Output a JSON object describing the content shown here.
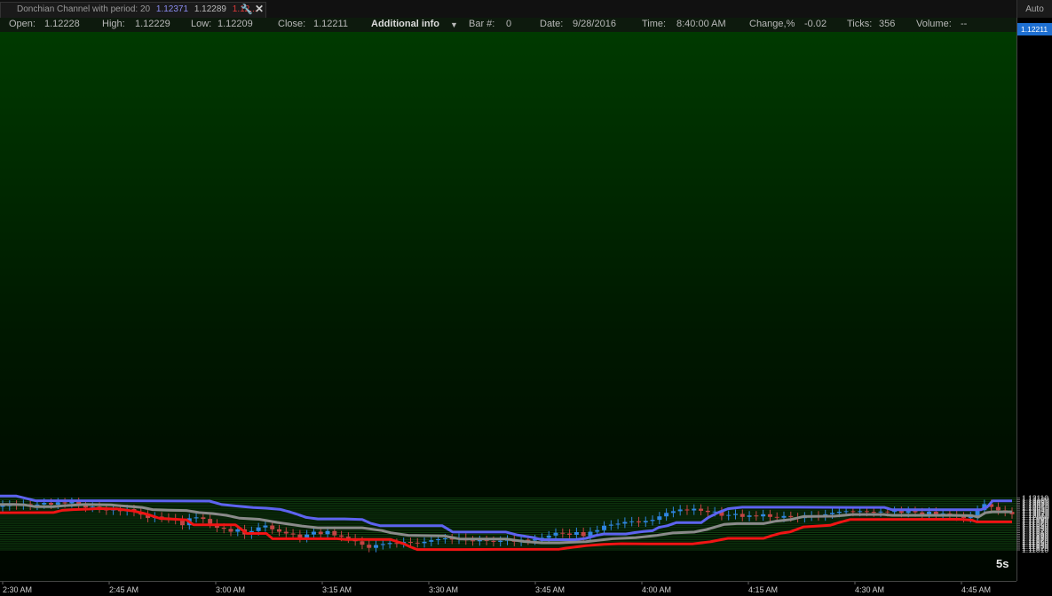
{
  "tab": {
    "label": "Donchian Channel with period: 20",
    "upper_value": "1.12371",
    "mid_value": "1.12289",
    "lower_value": "1.12..."
  },
  "toolbar": {
    "auto_label": "Auto",
    "period_label": "5s"
  },
  "infobar": {
    "open_label": "Open:",
    "open_value": "1.12228",
    "high_label": "High:",
    "high_value": "1.12229",
    "low_label": "Low:",
    "low_value": "1.12209",
    "close_label": "Close:",
    "close_value": "1.12211",
    "additional_info": "Additional info",
    "bar_label": "Bar #:",
    "bar_value": "0",
    "date_label": "Date:",
    "date_value": "9/28/2016",
    "time_label": "Time:",
    "time_value": "8:40:00 AM",
    "change_label": "Change,%",
    "change_value": "-0.02",
    "ticks_label": "Ticks:",
    "ticks_value": "356",
    "volume_label": "Volume:",
    "volume_value": "--"
  },
  "colors": {
    "upper_channel": "#5d63f0",
    "middle_channel": "#8a8a8a",
    "lower_channel": "#f01414",
    "bull_candle": "#2f86e0",
    "bear_candle": "#c24444",
    "price_marker": "#1e6fd1"
  },
  "chart_data": {
    "type": "candlestick",
    "current_price": "1.12211",
    "y_ticks": [
      "1.12110",
      "1.12100",
      "1.12090",
      "1.12080",
      "1.12070",
      "1.12060",
      "1.12050",
      "1.12040",
      "1.12030",
      "1.12020",
      "1.12010",
      "1.12000",
      "1.11990",
      "1.11980",
      "1.11970",
      "1.11960",
      "1.11950",
      "1.11940",
      "1.11930",
      "1.11920",
      "1.11910",
      "1.11900",
      "1.11890",
      "1.11880",
      "1.11870",
      "1.11860",
      "1.11850",
      "1.11840",
      "1.11830",
      "1.11820",
      "1.11810"
    ],
    "x_ticks": [
      "2:30 AM",
      "2:45 AM",
      "3:00 AM",
      "3:15 AM",
      "3:30 AM",
      "3:45 AM",
      "4:00 AM",
      "4:15 AM",
      "4:30 AM",
      "4:45 AM"
    ],
    "ylim": [
      1.11805,
      1.12115
    ],
    "candles": [
      [
        1.12059,
        1.12071
      ],
      [
        1.12063,
        1.12071
      ],
      [
        1.12071,
        1.12068
      ],
      [
        1.12068,
        1.12075
      ],
      [
        1.12075,
        1.12066
      ],
      [
        1.12066,
        1.12073
      ],
      [
        1.12073,
        1.12082
      ],
      [
        1.12082,
        1.12072
      ],
      [
        1.12072,
        1.12085
      ],
      [
        1.12085,
        1.12079
      ],
      [
        1.12079,
        1.12087
      ],
      [
        1.12087,
        1.12069
      ],
      [
        1.12069,
        1.12055
      ],
      [
        1.12055,
        1.1206
      ],
      [
        1.1206,
        1.1205
      ],
      [
        1.1205,
        1.12038
      ],
      [
        1.12038,
        1.12047
      ],
      [
        1.12047,
        1.12034
      ],
      [
        1.12034,
        1.12046
      ],
      [
        1.12046,
        1.1203
      ],
      [
        1.1203,
        1.12014
      ],
      [
        1.12014,
        1.11995
      ],
      [
        1.11995,
        1.12003
      ],
      [
        1.12003,
        1.11996
      ],
      [
        1.11996,
        1.11992
      ],
      [
        1.11992,
        1.11983
      ],
      [
        1.11983,
        1.11953
      ],
      [
        1.11953,
        1.11993
      ],
      [
        1.11993,
        1.11998
      ],
      [
        1.11998,
        1.11989
      ],
      [
        1.11989,
        1.11962
      ],
      [
        1.11962,
        1.11938
      ],
      [
        1.11938,
        1.11932
      ],
      [
        1.11932,
        1.11915
      ],
      [
        1.11915,
        1.11929
      ],
      [
        1.11929,
        1.11899
      ],
      [
        1.11899,
        1.11919
      ],
      [
        1.11919,
        1.1194
      ],
      [
        1.1194,
        1.11951
      ],
      [
        1.11951,
        1.11929
      ],
      [
        1.11929,
        1.11915
      ],
      [
        1.11915,
        1.11905
      ],
      [
        1.11905,
        1.11899
      ],
      [
        1.11899,
        1.11879
      ],
      [
        1.11879,
        1.11899
      ],
      [
        1.11899,
        1.11915
      ],
      [
        1.11915,
        1.11901
      ],
      [
        1.11901,
        1.11919
      ],
      [
        1.11919,
        1.11894
      ],
      [
        1.11894,
        1.11886
      ],
      [
        1.11886,
        1.11876
      ],
      [
        1.11876,
        1.1186
      ],
      [
        1.1186,
        1.1184
      ],
      [
        1.1184,
        1.11822
      ],
      [
        1.11822,
        1.11838
      ],
      [
        1.11838,
        1.11844
      ],
      [
        1.11844,
        1.1185
      ],
      [
        1.1185,
        1.11849
      ],
      [
        1.11849,
        1.11856
      ],
      [
        1.11856,
        1.11852
      ],
      [
        1.11852,
        1.11849
      ],
      [
        1.11849,
        1.11857
      ],
      [
        1.11857,
        1.11866
      ],
      [
        1.11866,
        1.11872
      ],
      [
        1.11872,
        1.11877
      ],
      [
        1.11877,
        1.1187
      ],
      [
        1.1187,
        1.11879
      ],
      [
        1.11879,
        1.11865
      ],
      [
        1.11865,
        1.1186
      ],
      [
        1.1186,
        1.11867
      ],
      [
        1.11867,
        1.11862
      ],
      [
        1.11862,
        1.11856
      ],
      [
        1.11856,
        1.11863
      ],
      [
        1.11863,
        1.1187
      ],
      [
        1.1187,
        1.11857
      ],
      [
        1.11857,
        1.11869
      ],
      [
        1.11869,
        1.11864
      ],
      [
        1.11864,
        1.11872
      ],
      [
        1.11872,
        1.1188
      ],
      [
        1.1188,
        1.11893
      ],
      [
        1.11893,
        1.11909
      ],
      [
        1.11909,
        1.11905
      ],
      [
        1.11905,
        1.11897
      ],
      [
        1.11897,
        1.11913
      ],
      [
        1.11913,
        1.1189
      ],
      [
        1.1189,
        1.11915
      ],
      [
        1.11915,
        1.11924
      ],
      [
        1.11924,
        1.1195
      ],
      [
        1.1195,
        1.11956
      ],
      [
        1.11956,
        1.11962
      ],
      [
        1.11962,
        1.11972
      ],
      [
        1.11972,
        1.11975
      ],
      [
        1.11975,
        1.11969
      ],
      [
        1.11969,
        1.11977
      ],
      [
        1.11977,
        1.11984
      ],
      [
        1.11984,
        1.12004
      ],
      [
        1.12004,
        1.12024
      ],
      [
        1.12024,
        1.12034
      ],
      [
        1.12034,
        1.12044
      ],
      [
        1.12044,
        1.12038
      ],
      [
        1.12038,
        1.12048
      ],
      [
        1.12048,
        1.12036
      ],
      [
        1.12036,
        1.12029
      ],
      [
        1.12029,
        1.12032
      ],
      [
        1.12032,
        1.12007
      ],
      [
        1.12007,
        1.12012
      ],
      [
        1.12012,
        1.12018
      ],
      [
        1.12018,
        1.12001
      ],
      [
        1.12001,
        1.12009
      ],
      [
        1.12009,
        1.12004
      ],
      [
        1.12004,
        1.12016
      ],
      [
        1.12016,
        1.12001
      ],
      [
        1.12001,
        1.11996
      ],
      [
        1.11996,
        1.12006
      ],
      [
        1.12006,
        1.11999
      ],
      [
        1.11999,
        1.11994
      ],
      [
        1.11994,
        1.12003
      ],
      [
        1.12003,
        1.12009
      ],
      [
        1.12009,
        1.12004
      ],
      [
        1.12004,
        1.12016
      ],
      [
        1.12016,
        1.12024
      ],
      [
        1.12024,
        1.12031
      ],
      [
        1.12031,
        1.12034
      ],
      [
        1.12034,
        1.1203
      ],
      [
        1.1203,
        1.12034
      ],
      [
        1.12034,
        1.1203
      ],
      [
        1.1203,
        1.12027
      ],
      [
        1.12027,
        1.12032
      ],
      [
        1.12032,
        1.12029
      ],
      [
        1.12029,
        1.12035
      ],
      [
        1.12035,
        1.12024
      ],
      [
        1.12024,
        1.12035
      ],
      [
        1.12035,
        1.12027
      ],
      [
        1.12027,
        1.12017
      ],
      [
        1.12017,
        1.12031
      ],
      [
        1.12031,
        1.12014
      ],
      [
        1.12014,
        1.12021
      ],
      [
        1.12021,
        1.12011
      ],
      [
        1.12011,
        1.12003
      ],
      [
        1.12003,
        1.11994
      ],
      [
        1.11994,
        1.12005
      ],
      [
        1.12005,
        1.1204
      ],
      [
        1.1204,
        1.12075
      ],
      [
        1.12075,
        1.12058
      ],
      [
        1.12058,
        1.12039
      ],
      [
        1.12039,
        1.1203
      ],
      [
        1.1203,
        1.12016
      ]
    ],
    "upper": [
      [
        0,
        1.12122
      ],
      [
        18,
        1.12122
      ],
      [
        40,
        1.12094
      ],
      [
        100,
        1.12094
      ],
      [
        236,
        1.12092
      ],
      [
        250,
        1.12072
      ],
      [
        266,
        1.12064
      ],
      [
        285,
        1.12055
      ],
      [
        300,
        1.12051
      ],
      [
        316,
        1.12044
      ],
      [
        326,
        1.1203
      ],
      [
        335,
        1.12016
      ],
      [
        345,
        1.11998
      ],
      [
        358,
        1.11989
      ],
      [
        388,
        1.11989
      ],
      [
        408,
        1.11986
      ],
      [
        418,
        1.11963
      ],
      [
        428,
        1.1195
      ],
      [
        498,
        1.1195
      ],
      [
        510,
        1.11913
      ],
      [
        570,
        1.11913
      ],
      [
        582,
        1.11897
      ],
      [
        600,
        1.11882
      ],
      [
        610,
        1.11869
      ],
      [
        630,
        1.11869
      ],
      [
        648,
        1.11869
      ],
      [
        660,
        1.11877
      ],
      [
        672,
        1.11894
      ],
      [
        680,
        1.11902
      ],
      [
        705,
        1.11902
      ],
      [
        715,
        1.1191
      ],
      [
        725,
        1.11917
      ],
      [
        735,
        1.11921
      ],
      [
        742,
        1.1194
      ],
      [
        752,
        1.1195
      ],
      [
        762,
        1.11968
      ],
      [
        790,
        1.11968
      ],
      [
        798,
        1.11998
      ],
      [
        808,
        1.12024
      ],
      [
        820,
        1.12048
      ],
      [
        836,
        1.12057
      ],
      [
        900,
        1.12057
      ],
      [
        960,
        1.12056
      ],
      [
        996,
        1.12056
      ],
      [
        1005,
        1.12042
      ],
      [
        1105,
        1.12042
      ],
      [
        1112,
        1.12058
      ],
      [
        1118,
        1.12093
      ],
      [
        1140,
        1.12093
      ]
    ],
    "middle": [
      [
        0,
        1.12072
      ],
      [
        15,
        1.12073
      ],
      [
        28,
        1.1207
      ],
      [
        40,
        1.1206
      ],
      [
        60,
        1.1206
      ],
      [
        72,
        1.12066
      ],
      [
        95,
        1.12072
      ],
      [
        125,
        1.1207
      ],
      [
        160,
        1.12056
      ],
      [
        172,
        1.12043
      ],
      [
        190,
        1.1204
      ],
      [
        210,
        1.12038
      ],
      [
        224,
        1.12026
      ],
      [
        240,
        1.1202
      ],
      [
        255,
        1.1201
      ],
      [
        270,
        1.11993
      ],
      [
        292,
        1.11987
      ],
      [
        312,
        1.11969
      ],
      [
        340,
        1.11948
      ],
      [
        358,
        1.11938
      ],
      [
        408,
        1.11938
      ],
      [
        430,
        1.11922
      ],
      [
        440,
        1.11909
      ],
      [
        460,
        1.11894
      ],
      [
        500,
        1.11891
      ],
      [
        518,
        1.11873
      ],
      [
        570,
        1.11873
      ],
      [
        590,
        1.11859
      ],
      [
        610,
        1.11851
      ],
      [
        630,
        1.11851
      ],
      [
        660,
        1.11858
      ],
      [
        690,
        1.11875
      ],
      [
        716,
        1.11881
      ],
      [
        740,
        1.11894
      ],
      [
        758,
        1.11908
      ],
      [
        782,
        1.11913
      ],
      [
        796,
        1.11928
      ],
      [
        804,
        1.1194
      ],
      [
        816,
        1.11958
      ],
      [
        830,
        1.11962
      ],
      [
        860,
        1.11962
      ],
      [
        873,
        1.11975
      ],
      [
        890,
        1.11985
      ],
      [
        905,
        1.12003
      ],
      [
        940,
        1.12005
      ],
      [
        960,
        1.12015
      ],
      [
        995,
        1.12015
      ],
      [
        1005,
        1.1201
      ],
      [
        1070,
        1.1201
      ],
      [
        1095,
        1.12008
      ],
      [
        1102,
        1.12
      ],
      [
        1110,
        1.12025
      ],
      [
        1118,
        1.1203
      ],
      [
        1140,
        1.1203
      ]
    ],
    "lower": [
      [
        0,
        1.12025
      ],
      [
        60,
        1.12026
      ],
      [
        70,
        1.12039
      ],
      [
        82,
        1.12043
      ],
      [
        100,
        1.12046
      ],
      [
        110,
        1.12049
      ],
      [
        132,
        1.12047
      ],
      [
        150,
        1.12035
      ],
      [
        160,
        1.12024
      ],
      [
        168,
        1.12012
      ],
      [
        180,
        1.11992
      ],
      [
        205,
        1.11985
      ],
      [
        210,
        1.11984
      ],
      [
        218,
        1.11955
      ],
      [
        265,
        1.11955
      ],
      [
        270,
        1.11937
      ],
      [
        278,
        1.11905
      ],
      [
        300,
        1.11905
      ],
      [
        307,
        1.11875
      ],
      [
        380,
        1.11875
      ],
      [
        390,
        1.1187
      ],
      [
        440,
        1.1187
      ],
      [
        455,
        1.11845
      ],
      [
        462,
        1.11828
      ],
      [
        470,
        1.11812
      ],
      [
        520,
        1.11812
      ],
      [
        560,
        1.11813
      ],
      [
        630,
        1.11814
      ],
      [
        640,
        1.11822
      ],
      [
        660,
        1.11835
      ],
      [
        680,
        1.11842
      ],
      [
        700,
        1.11846
      ],
      [
        730,
        1.11845
      ],
      [
        780,
        1.11845
      ],
      [
        800,
        1.11857
      ],
      [
        820,
        1.11877
      ],
      [
        860,
        1.11877
      ],
      [
        870,
        1.11893
      ],
      [
        880,
        1.11907
      ],
      [
        890,
        1.11914
      ],
      [
        905,
        1.11943
      ],
      [
        935,
        1.11952
      ],
      [
        945,
        1.11968
      ],
      [
        958,
        1.11986
      ],
      [
        1080,
        1.11987
      ],
      [
        1095,
        1.11982
      ],
      [
        1100,
        1.11972
      ],
      [
        1140,
        1.11972
      ]
    ]
  }
}
